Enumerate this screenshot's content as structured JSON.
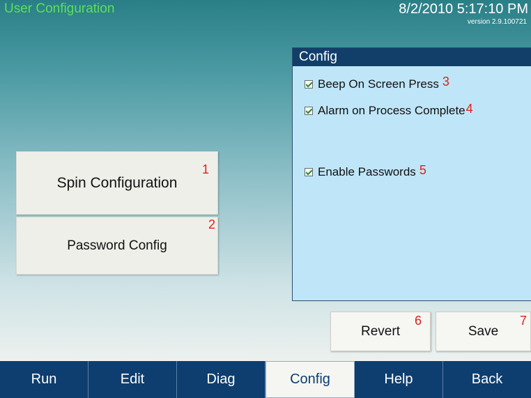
{
  "header": {
    "title": "User Configuration",
    "datetime": "8/2/2010 5:17:10 PM",
    "version": "version 2.9.100721"
  },
  "side_buttons": {
    "spin": {
      "label": "Spin Configuration",
      "badge": "1"
    },
    "password": {
      "label": "Password Config",
      "badge": "2"
    }
  },
  "config": {
    "title": "Config",
    "options": [
      {
        "label": "Beep On Screen Press",
        "checked": true,
        "badge": "3"
      },
      {
        "label": "Alarm on Process Complete",
        "checked": true,
        "badge": "4"
      },
      {
        "label": "Enable Passwords",
        "checked": true,
        "badge": "5"
      }
    ]
  },
  "actions": {
    "revert": {
      "label": "Revert",
      "badge": "6"
    },
    "save": {
      "label": "Save",
      "badge": "7"
    }
  },
  "tabs": [
    {
      "label": "Run"
    },
    {
      "label": "Edit"
    },
    {
      "label": "Diag"
    },
    {
      "label": "Config",
      "active": true
    },
    {
      "label": "Help"
    },
    {
      "label": "Back"
    }
  ],
  "colors": {
    "title": "#59e05a",
    "tabbar": "#0d3e6f",
    "panel": "#bfe6f8",
    "badge": "#e0201a"
  }
}
